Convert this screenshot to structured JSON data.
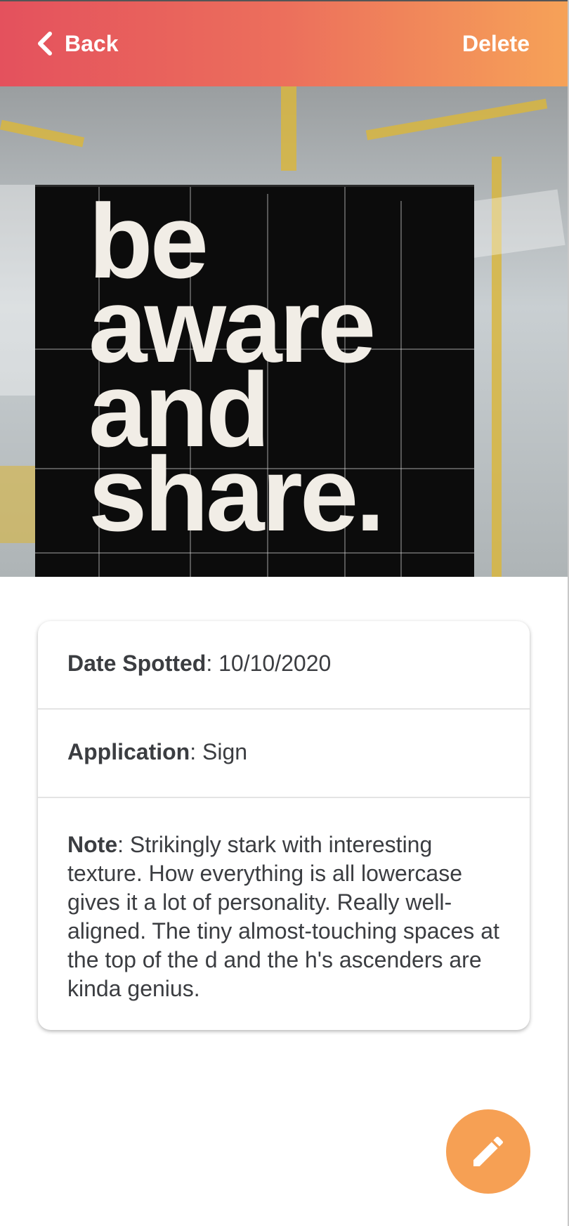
{
  "header": {
    "back_label": "Back",
    "delete_label": "Delete"
  },
  "photo": {
    "poster_lines": [
      "be",
      "aware",
      "and",
      "share."
    ]
  },
  "details": {
    "date": {
      "label": "Date Spotted",
      "separator": ":",
      "value": " 10/10/2020"
    },
    "application": {
      "label": "Application",
      "separator": ":",
      "value": " Sign"
    },
    "note": {
      "label": "Note",
      "separator": ":",
      "value": " Strikingly stark with interesting texture. How everything is all lowercase gives it a lot of personality. Really well-aligned. The tiny almost-touching spaces at the top of the d and the h's ascenders are kinda genius."
    }
  },
  "fab": {
    "icon": "pencil-icon"
  },
  "colors": {
    "header_gradient_start": "#e4515d",
    "header_gradient_end": "#f6a258",
    "fab": "#f6a054",
    "text": "#3b3d41"
  }
}
